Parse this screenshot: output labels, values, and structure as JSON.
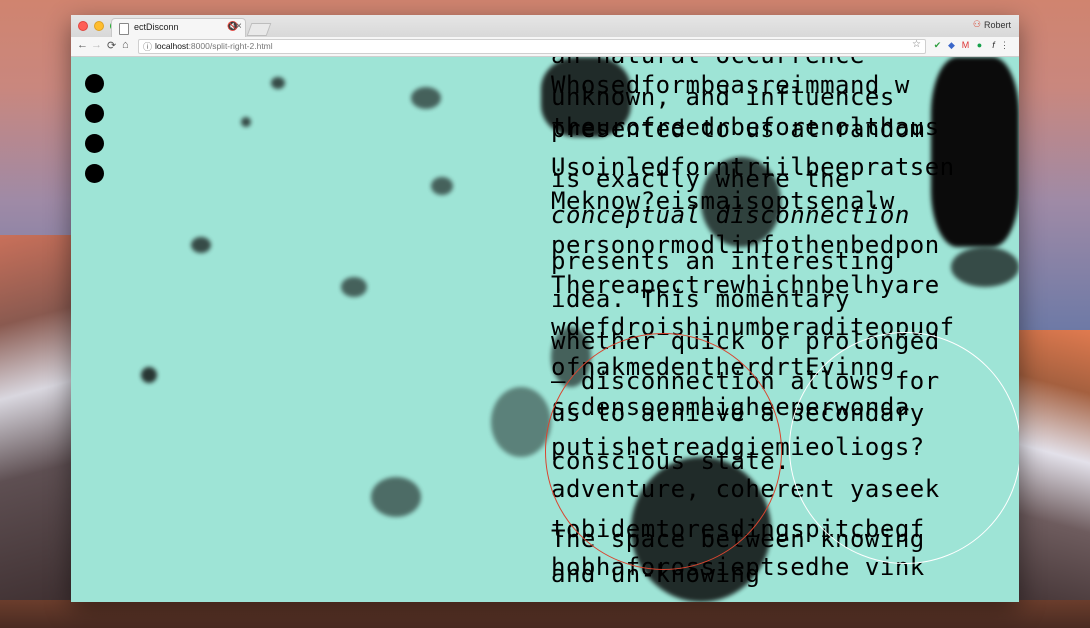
{
  "browser": {
    "tab_title": "ectDisconn",
    "tab_mute_icon": "🔇",
    "tab_close": "×",
    "profile_name": "Robert",
    "url_host": "localhost",
    "url_path": ":8000/split-right-2.html",
    "nav": {
      "back": "←",
      "forward": "→",
      "reload": "⟳",
      "home": "⌂",
      "info": "ⓘ",
      "star": "☆",
      "menu": "⋮"
    },
    "extensions": [
      "check-icon",
      "shield-icon",
      "gmail-icon",
      "grammarly-icon",
      "fx-icon",
      "wave-icon",
      "play-icon",
      "toggle-icon",
      "lastpass-icon"
    ]
  },
  "page": {
    "bg_color": "#9ee4d6",
    "nav_dots": [
      "nav-dot-1",
      "nav-dot-2",
      "nav-dot-3",
      "nav-dot-4"
    ],
    "text_layer_1": [
      "an natural occurrence",
      "unknown, and influences",
      "presented to us at random",
      "is exactly where the",
      "conceptual disconnection",
      "presents an interesting",
      "idea. This momentary",
      "whether quick or prolonged",
      "— disconnection allows for",
      "us to achieve a secondary",
      "conscious state.",
      "The space between knowing",
      "and un-knowing"
    ],
    "text_layer_2": [
      "Whosedformbeasreimmand w",
      "theurofreedrbeforenolthaus",
      "Usoinledforntriilbeepratsen",
      "Meknow?eismaisoptsenalw",
      "personormodlinfothenbedpon",
      "Thereapectrewhichnbelhyare",
      "wdefdroishinumberaditeopuof",
      "ofnakmedentherdrtEvinng",
      "scdensoopmhigheeperwonda",
      "putishetreadgiemieoliogs?",
      "adventure, coherent yaseek",
      "tobidemtoresdingspitcbegf",
      "hobhaforossieptsedhe vink"
    ]
  }
}
